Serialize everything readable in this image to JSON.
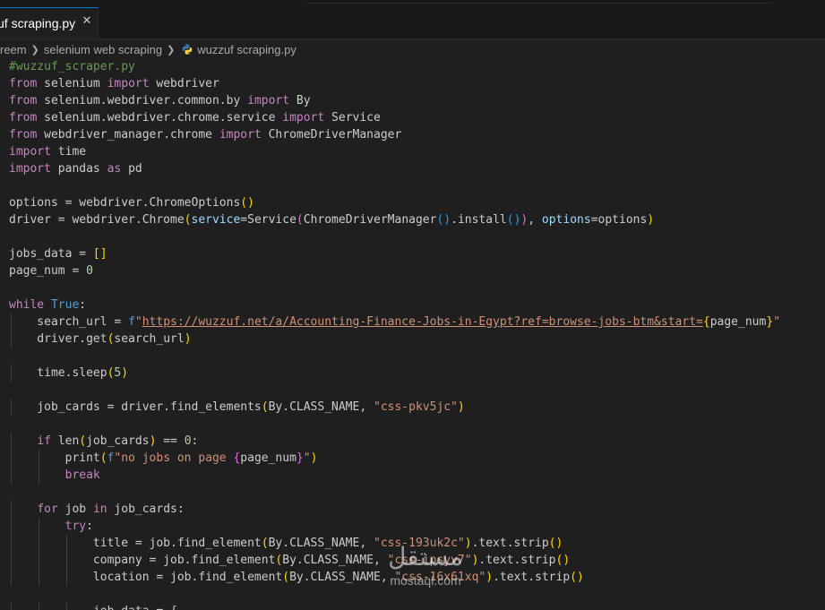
{
  "tab": {
    "label": "zuf scraping.py",
    "close_glyph": "✕"
  },
  "breadcrumb": {
    "items": [
      "reem",
      "selenium web scraping",
      "wuzzuf scraping.py"
    ]
  },
  "watermark": {
    "logo": "مستقل",
    "text": "mostaql.com"
  },
  "code_lines": [
    [
      {
        "t": "#wuzzuf_scraper.py",
        "c": "comment"
      }
    ],
    [
      {
        "t": "from",
        "c": "kw"
      },
      {
        "t": " selenium ",
        "c": "plain"
      },
      {
        "t": "import",
        "c": "kw"
      },
      {
        "t": " webdriver",
        "c": "plain"
      }
    ],
    [
      {
        "t": "from",
        "c": "kw"
      },
      {
        "t": " selenium.webdriver.common.by ",
        "c": "plain"
      },
      {
        "t": "import",
        "c": "kw"
      },
      {
        "t": " By",
        "c": "plain"
      }
    ],
    [
      {
        "t": "from",
        "c": "kw"
      },
      {
        "t": " selenium.webdriver.chrome.service ",
        "c": "plain"
      },
      {
        "t": "import",
        "c": "kw"
      },
      {
        "t": " Service",
        "c": "plain"
      }
    ],
    [
      {
        "t": "from",
        "c": "kw"
      },
      {
        "t": " webdriver_manager.chrome ",
        "c": "plain"
      },
      {
        "t": "import",
        "c": "kw"
      },
      {
        "t": " ChromeDriverManager",
        "c": "plain"
      }
    ],
    [
      {
        "t": "import",
        "c": "kw"
      },
      {
        "t": " time",
        "c": "plain"
      }
    ],
    [
      {
        "t": "import",
        "c": "kw"
      },
      {
        "t": " pandas ",
        "c": "plain"
      },
      {
        "t": "as",
        "c": "kw"
      },
      {
        "t": " pd",
        "c": "plain"
      }
    ],
    [],
    [
      {
        "t": "options = webdriver.ChromeOptions",
        "c": "plain"
      },
      {
        "t": "()",
        "c": "br1"
      }
    ],
    [
      {
        "t": "driver = webdriver.Chrome",
        "c": "plain"
      },
      {
        "t": "(",
        "c": "br1"
      },
      {
        "t": "service",
        "c": "var"
      },
      {
        "t": "=Service",
        "c": "plain"
      },
      {
        "t": "(",
        "c": "br2"
      },
      {
        "t": "ChromeDriverManager",
        "c": "plain"
      },
      {
        "t": "()",
        "c": "br3"
      },
      {
        "t": ".install",
        "c": "plain"
      },
      {
        "t": "()",
        "c": "br3"
      },
      {
        "t": ")",
        "c": "br2"
      },
      {
        "t": ", ",
        "c": "plain"
      },
      {
        "t": "options",
        "c": "var"
      },
      {
        "t": "=options",
        "c": "plain"
      },
      {
        "t": ")",
        "c": "br1"
      }
    ],
    [],
    [
      {
        "t": "jobs_data = ",
        "c": "plain"
      },
      {
        "t": "[]",
        "c": "br1"
      }
    ],
    [
      {
        "t": "page_num = ",
        "c": "plain"
      },
      {
        "t": "0",
        "c": "num"
      }
    ],
    [],
    [
      {
        "t": "while",
        "c": "kw"
      },
      {
        "t": " ",
        "c": "plain"
      },
      {
        "t": "True",
        "c": "blue"
      },
      {
        "t": ":",
        "c": "plain"
      }
    ],
    [
      {
        "t": "    search_url = ",
        "c": "plain"
      },
      {
        "t": "f",
        "c": "blue"
      },
      {
        "t": "\"",
        "c": "str"
      },
      {
        "t": "https://wuzzuf.net/a/Accounting-Finance-Jobs-in-Egypt?ref=browse-jobs-btm&start=",
        "c": "url"
      },
      {
        "t": "{",
        "c": "br1"
      },
      {
        "t": "page_num",
        "c": "plain"
      },
      {
        "t": "}",
        "c": "br1"
      },
      {
        "t": "\"",
        "c": "str"
      }
    ],
    [
      {
        "t": "    driver.get",
        "c": "plain"
      },
      {
        "t": "(",
        "c": "br1"
      },
      {
        "t": "search_url",
        "c": "plain"
      },
      {
        "t": ")",
        "c": "br1"
      }
    ],
    [],
    [
      {
        "t": "    time.sleep",
        "c": "plain"
      },
      {
        "t": "(",
        "c": "br1"
      },
      {
        "t": "5",
        "c": "num"
      },
      {
        "t": ")",
        "c": "br1"
      }
    ],
    [],
    [
      {
        "t": "    job_cards = driver.find_elements",
        "c": "plain"
      },
      {
        "t": "(",
        "c": "br1"
      },
      {
        "t": "By.CLASS_NAME, ",
        "c": "plain"
      },
      {
        "t": "\"css-pkv5jc\"",
        "c": "str"
      },
      {
        "t": ")",
        "c": "br1"
      }
    ],
    [],
    [
      {
        "t": "    ",
        "c": "plain"
      },
      {
        "t": "if",
        "c": "kw"
      },
      {
        "t": " len",
        "c": "plain"
      },
      {
        "t": "(",
        "c": "br1"
      },
      {
        "t": "job_cards",
        "c": "plain"
      },
      {
        "t": ")",
        "c": "br1"
      },
      {
        "t": " == ",
        "c": "plain"
      },
      {
        "t": "0",
        "c": "num"
      },
      {
        "t": ":",
        "c": "plain"
      }
    ],
    [
      {
        "t": "        print",
        "c": "plain"
      },
      {
        "t": "(",
        "c": "br1"
      },
      {
        "t": "f",
        "c": "blue"
      },
      {
        "t": "\"no jobs on page ",
        "c": "str"
      },
      {
        "t": "{",
        "c": "br2"
      },
      {
        "t": "page_num",
        "c": "plain"
      },
      {
        "t": "}",
        "c": "br2"
      },
      {
        "t": "\"",
        "c": "str"
      },
      {
        "t": ")",
        "c": "br1"
      }
    ],
    [
      {
        "t": "        ",
        "c": "plain"
      },
      {
        "t": "break",
        "c": "kw"
      }
    ],
    [],
    [
      {
        "t": "    ",
        "c": "plain"
      },
      {
        "t": "for",
        "c": "kw"
      },
      {
        "t": " job ",
        "c": "plain"
      },
      {
        "t": "in",
        "c": "kw"
      },
      {
        "t": " job_cards:",
        "c": "plain"
      }
    ],
    [
      {
        "t": "        ",
        "c": "plain"
      },
      {
        "t": "try",
        "c": "kw"
      },
      {
        "t": ":",
        "c": "plain"
      }
    ],
    [
      {
        "t": "            title = job.find_element",
        "c": "plain"
      },
      {
        "t": "(",
        "c": "br1"
      },
      {
        "t": "By.CLASS_NAME, ",
        "c": "plain"
      },
      {
        "t": "\"css-193uk2c\"",
        "c": "str"
      },
      {
        "t": ")",
        "c": "br1"
      },
      {
        "t": ".text.strip",
        "c": "plain"
      },
      {
        "t": "()",
        "c": "br1"
      }
    ],
    [
      {
        "t": "            company = job.find_element",
        "c": "plain"
      },
      {
        "t": "(",
        "c": "br1"
      },
      {
        "t": "By.CLASS_NAME, ",
        "c": "plain"
      },
      {
        "t": "\"css-ipsyv7\"",
        "c": "str"
      },
      {
        "t": ")",
        "c": "br1"
      },
      {
        "t": ".text.strip",
        "c": "plain"
      },
      {
        "t": "()",
        "c": "br1"
      }
    ],
    [
      {
        "t": "            location = job.find_element",
        "c": "plain"
      },
      {
        "t": "(",
        "c": "br1"
      },
      {
        "t": "By.CLASS_NAME, ",
        "c": "plain"
      },
      {
        "t": "\"css-16x61xq\"",
        "c": "str"
      },
      {
        "t": ")",
        "c": "br1"
      },
      {
        "t": ".text.strip",
        "c": "plain"
      },
      {
        "t": "()",
        "c": "br1"
      }
    ],
    [],
    [
      {
        "t": "            job_data = {",
        "c": "plain"
      }
    ]
  ]
}
